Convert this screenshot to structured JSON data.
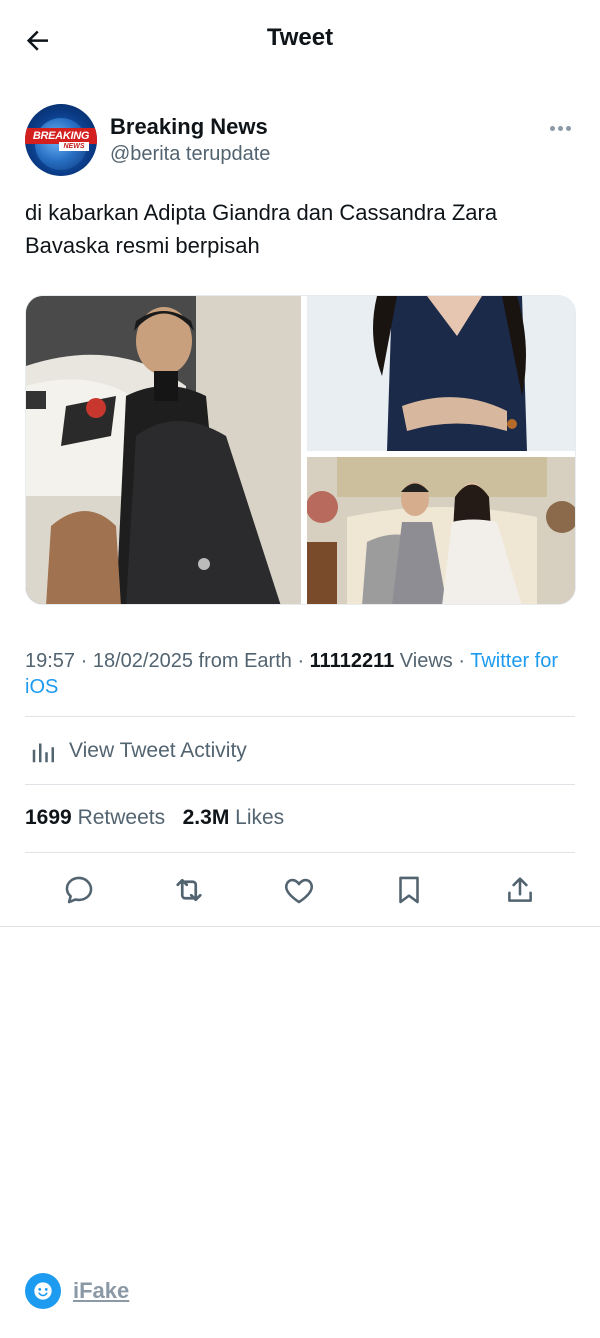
{
  "header": {
    "title": "Tweet",
    "back_icon": "arrow-left-icon"
  },
  "author": {
    "name": "Breaking News",
    "handle": "@berita terupdate",
    "avatar_text": "BREAKING",
    "avatar_subtext": "NEWS"
  },
  "tweet": {
    "text": "di kabarkan Adipta Giandra dan Cassandra Zara Bavaska resmi berpisah"
  },
  "meta": {
    "time": "19:57",
    "date": "18/02/2025",
    "location": "from Earth",
    "views_count": "11112211",
    "views_label": "Views",
    "source": "Twitter for iOS"
  },
  "activity": {
    "label": "View Tweet Activity"
  },
  "stats": {
    "retweets_count": "1699",
    "retweets_label": "Retweets",
    "likes_count": "2.3M",
    "likes_label": "Likes"
  },
  "actions": [
    "reply-icon",
    "retweet-icon",
    "like-icon",
    "bookmark-icon",
    "share-icon"
  ],
  "footer": {
    "label": "iFake"
  },
  "colors": {
    "accent": "#1d9bf0",
    "muted": "#536471",
    "text": "#0f1419"
  }
}
